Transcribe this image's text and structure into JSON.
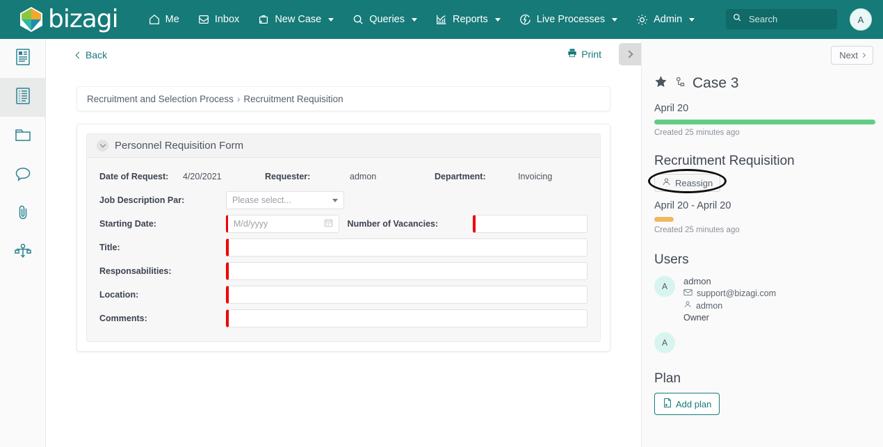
{
  "brand": {
    "name": "bizagi",
    "header_color": "#157a78",
    "accent": "#157a78"
  },
  "topnav": {
    "items": [
      {
        "label": "Me",
        "icon": "home-icon",
        "has_caret": false
      },
      {
        "label": "Inbox",
        "icon": "inbox-icon",
        "has_caret": false
      },
      {
        "label": "New Case",
        "icon": "new-case-icon",
        "has_caret": true
      },
      {
        "label": "Queries",
        "icon": "search-icon",
        "has_caret": true
      },
      {
        "label": "Reports",
        "icon": "reports-icon",
        "has_caret": true
      },
      {
        "label": "Live Processes",
        "icon": "live-processes-icon",
        "has_caret": true
      },
      {
        "label": "Admin",
        "icon": "gear-icon",
        "has_caret": true
      }
    ],
    "search_placeholder": "Search",
    "search_value": "",
    "avatar_initial": "A"
  },
  "left_rail": {
    "items": [
      {
        "name": "form-icon",
        "active": false
      },
      {
        "name": "activities-list-icon",
        "active": true
      },
      {
        "name": "folder-icon",
        "active": false
      },
      {
        "name": "comments-icon",
        "active": false
      },
      {
        "name": "attachments-icon",
        "active": false
      },
      {
        "name": "process-diagram-icon",
        "active": false
      }
    ]
  },
  "toolbar": {
    "back_label": "Back",
    "print_label": "Print",
    "panel_toggle_icon": "chevron-right-icon"
  },
  "breadcrumb": {
    "process": "Recruitment and Selection Process",
    "separator": "›",
    "activity": "Recruitment Requisition"
  },
  "form": {
    "title": "Personnel Requisition Form",
    "collapse_icon": "chevron-down-icon",
    "fields": [
      {
        "label": "Date of Request:",
        "type": "text-value",
        "value": "4/20/2021"
      },
      {
        "label": "Requester:",
        "type": "text-value",
        "value": "admon"
      },
      {
        "label": "Department:",
        "type": "text-value",
        "value": "Invoicing"
      },
      {
        "label": "Job Description Par:",
        "type": "select",
        "value": "",
        "placeholder": "Please select...",
        "required": false
      },
      {
        "label": "Starting Date:",
        "type": "date",
        "value": "",
        "placeholder": "M/d/yyyy",
        "required": true
      },
      {
        "label": "Number of Vacancies:",
        "type": "number",
        "value": "",
        "placeholder": "",
        "required": true
      },
      {
        "label": "Title:",
        "type": "text",
        "value": "",
        "placeholder": "",
        "required": true
      },
      {
        "label": "Responsabilities:",
        "type": "text",
        "value": "",
        "placeholder": "",
        "required": true
      },
      {
        "label": "Location:",
        "type": "text",
        "value": "",
        "placeholder": "",
        "required": true
      },
      {
        "label": "Comments:",
        "type": "text",
        "value": "",
        "placeholder": "",
        "required": true
      }
    ],
    "required_marker_color": "#ef0000"
  },
  "right_panel": {
    "next_label": "Next",
    "case": {
      "title": "Case 3",
      "favorite_icon": "star-filled-icon",
      "case_icon": "case-node-icon",
      "date": "April 20",
      "progress_color": "#62cc84",
      "created": "Created 25 minutes ago"
    },
    "activity": {
      "title": "Recruitment Requisition",
      "reassign_label": "Reassign",
      "reassign_icon": "user-icon",
      "date_range": "April 20 - April 20",
      "progress_color": "#f0b860",
      "created": "Created 25 minutes ago",
      "highlighted": true
    },
    "users": {
      "heading": "Users",
      "list": [
        {
          "initial": "A",
          "name": "admon",
          "email": "support@bizagi.com",
          "email_icon": "envelope-icon",
          "username": "admon",
          "username_icon": "user-icon",
          "role": "Owner"
        },
        {
          "initial": "A",
          "name": "",
          "email": "",
          "username": "",
          "role": ""
        }
      ]
    },
    "plan": {
      "heading": "Plan",
      "add_label": "Add plan",
      "add_icon": "file-plus-icon"
    }
  }
}
